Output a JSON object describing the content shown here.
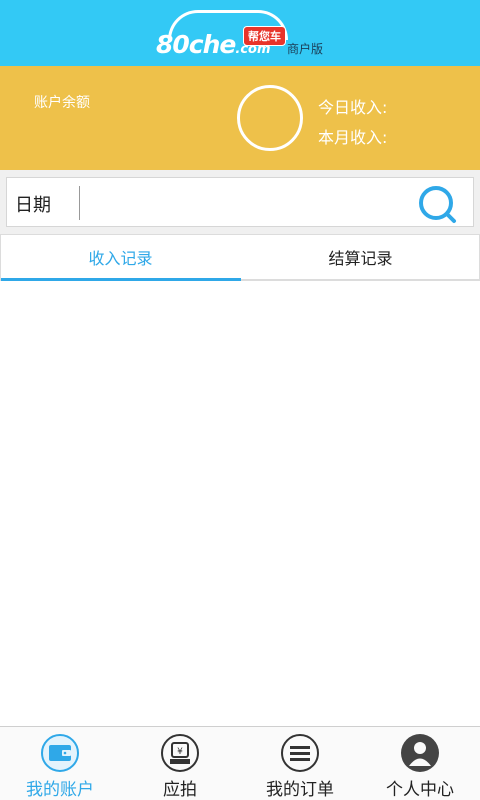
{
  "header": {
    "brand_text": "80che",
    "brand_suffix": ".com",
    "badge_text": "帮您车",
    "edition_text": "商户版",
    "background_color": "#33c9f5"
  },
  "account": {
    "balance_label": "账户余额",
    "today_income_label": "今日收入:",
    "month_income_label": "本月收入:",
    "background_color": "#eec14a"
  },
  "search": {
    "date_label": "日期",
    "date_value": "",
    "search_icon": "search-icon"
  },
  "tabs": [
    {
      "label": "收入记录",
      "active": true
    },
    {
      "label": "结算记录",
      "active": false
    }
  ],
  "bottom_nav": [
    {
      "label": "我的账户",
      "icon": "wallet-icon",
      "active": true
    },
    {
      "label": "应拍",
      "icon": "auction-icon",
      "active": false
    },
    {
      "label": "我的订单",
      "icon": "list-icon",
      "active": false
    },
    {
      "label": "个人中心",
      "icon": "user-icon",
      "active": false
    }
  ],
  "accent_color": "#2fa8e8"
}
